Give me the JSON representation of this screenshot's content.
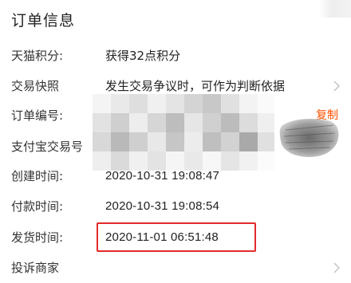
{
  "section_title": "订单信息",
  "rows": {
    "points": {
      "label": "天猫积分:",
      "value": "获得32点积分"
    },
    "snapshot": {
      "label": "交易快照",
      "value": "发生交易争议时，可作为判断依据"
    },
    "order_no": {
      "label": "订单编号:",
      "action": "复制"
    },
    "alipay_no": {
      "label": "支付宝交易号"
    },
    "created": {
      "label": "创建时间:",
      "value": "2020-10-31 19:08:47"
    },
    "paid": {
      "label": "付款时间:",
      "value": "2020-10-31 19:08:54"
    },
    "shipped": {
      "label": "发货时间:",
      "value": "2020-11-01 06:51:48"
    },
    "complain": {
      "label": "投诉商家"
    }
  },
  "colors": {
    "accent": "#ff5000",
    "highlight": "#e42a2a",
    "chevron": "#bdbdbd"
  },
  "icons": {
    "snapshot_chevron": "chevron-right-icon",
    "complain_chevron": "chevron-right-icon"
  }
}
